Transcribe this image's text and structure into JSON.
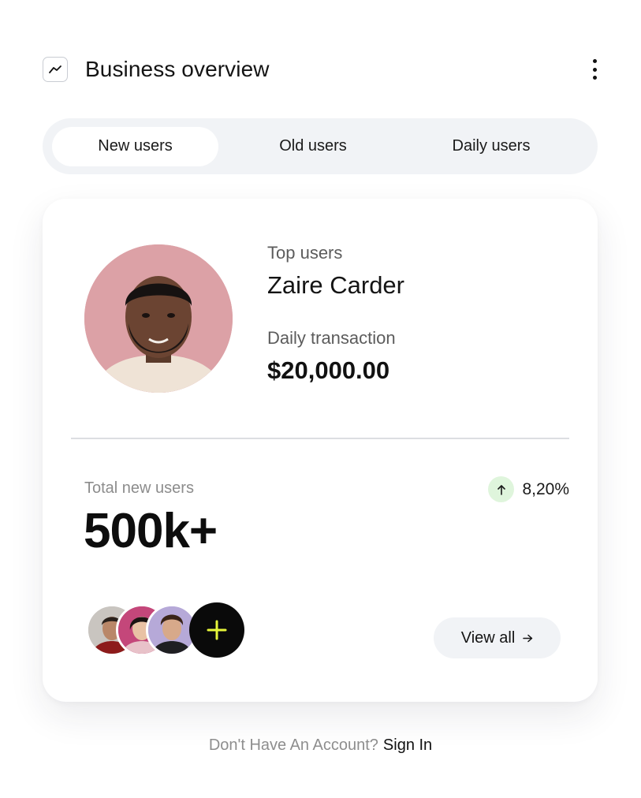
{
  "header": {
    "title": "Business overview",
    "icon": "trend-chart-icon",
    "menu_icon": "more-vertical-icon"
  },
  "tabs": [
    {
      "label": "New users",
      "active": true
    },
    {
      "label": "Old users",
      "active": false
    },
    {
      "label": "Daily users",
      "active": false
    }
  ],
  "top_user": {
    "section_label": "Top users",
    "name": "Zaire Carder",
    "transaction_label": "Daily transaction",
    "transaction_value": "$20,000.00"
  },
  "stats": {
    "total_label": "Total new users",
    "total_value": "500k+",
    "growth_value": "8,20%",
    "growth_icon": "arrow-up-icon",
    "growth_color": "#dff5dc"
  },
  "user_stack": {
    "avatars": [
      "avatar-1",
      "avatar-2",
      "avatar-3"
    ],
    "add_icon": "plus-icon",
    "add_icon_color": "#e6f53a"
  },
  "view_all": {
    "label": "View all",
    "icon": "arrow-right-icon"
  },
  "footer": {
    "prompt": "Don't Have An Account?",
    "link": "Sign In"
  }
}
